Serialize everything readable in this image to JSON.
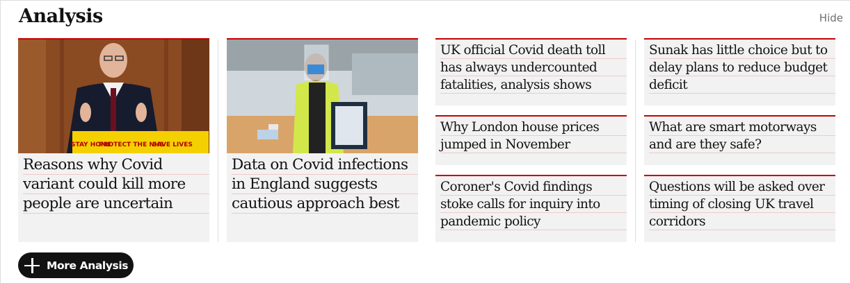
{
  "section": {
    "title": "Analysis",
    "hide_label": "Hide"
  },
  "cards": [
    {
      "headline": "Reasons why Covid variant could kill more people are uncertain",
      "image": "man-at-podium-photo"
    },
    {
      "headline": "Data on Covid infections in England suggests cautious approach best",
      "image": "testing-centre-photo"
    },
    {
      "headline": "UK official Covid death toll has always undercounted fatalities, analysis shows"
    },
    {
      "headline": "Sunak has little choice but to delay plans to reduce budget deficit"
    },
    {
      "headline": "Why London house prices jumped in November"
    },
    {
      "headline": "What are smart motorways and are they safe?"
    },
    {
      "headline": "Coroner's Covid findings stoke calls for inquiry into pandemic policy"
    },
    {
      "headline": "Questions will be asked over timing of closing UK travel corridors"
    }
  ],
  "podium_sign": {
    "left": "STAY HOME",
    "middle": "PROTECT THE NHS",
    "right": "SAVE LIVES"
  },
  "more_button": {
    "label": "More Analysis",
    "icon": "plus-icon"
  },
  "colors": {
    "accent": "#c70000",
    "card_bg": "#f2f2f2",
    "button_bg": "#121212"
  }
}
